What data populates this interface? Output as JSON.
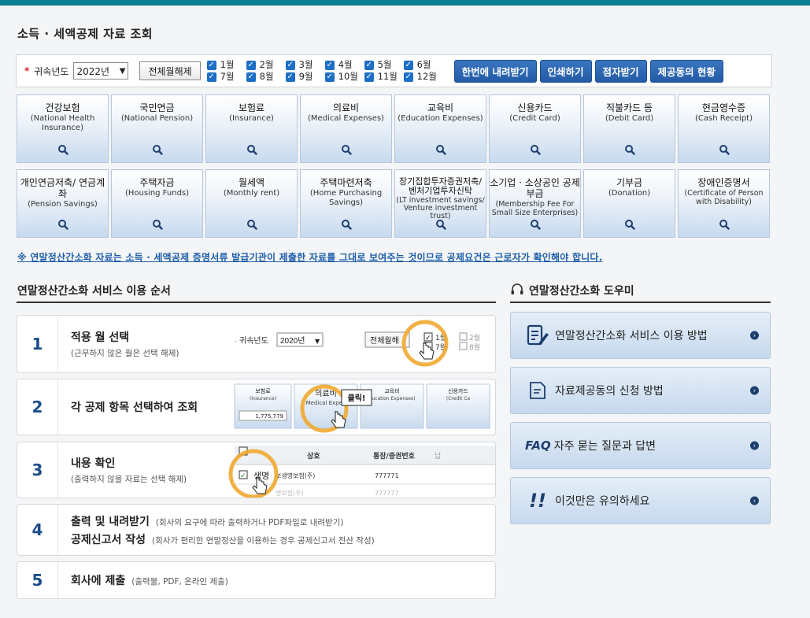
{
  "page_title": "소득 · 세액공제 자료 조회",
  "filter": {
    "required_mark": "*",
    "year_label": "귀속년도",
    "year_value": "2022년",
    "clear_all_label": "전체월해제",
    "months": [
      "1월",
      "2월",
      "3월",
      "4월",
      "5월",
      "6월",
      "7월",
      "8월",
      "9월",
      "10월",
      "11월",
      "12월"
    ],
    "checkbox_mark": "✓",
    "actions": [
      "한번에 내려받기",
      "인쇄하기",
      "점자받기",
      "제공동의 현황"
    ]
  },
  "categories": [
    {
      "title": "건강보험",
      "sub": "(National Health Insurance)"
    },
    {
      "title": "국민연금",
      "sub": "(National Pension)"
    },
    {
      "title": "보험료",
      "sub": "(Insurance)"
    },
    {
      "title": "의료비",
      "sub": "(Medical Expenses)"
    },
    {
      "title": "교육비",
      "sub": "(Education Expenses)"
    },
    {
      "title": "신용카드",
      "sub": "(Credit Card)"
    },
    {
      "title": "직불카드 등",
      "sub": "(Debit Card)"
    },
    {
      "title": "현금영수증",
      "sub": "(Cash Receipt)"
    },
    {
      "title": "개인연금저축/ 연금계좌",
      "sub": "(Pension Savings)"
    },
    {
      "title": "주택자금",
      "sub": "(Housing Funds)"
    },
    {
      "title": "월세액",
      "sub": "(Monthly rent)"
    },
    {
      "title": "주택마련저축",
      "sub": "(Home Purchasing Savings)"
    },
    {
      "title": "장기집합투자증권저축/ 벤처기업투자신탁",
      "sub": "(LT investment savings/ Venture investment trust)"
    },
    {
      "title": "소기업 · 소상공인 공제부금",
      "sub": "(Membership Fee For Small Size Enterprises)"
    },
    {
      "title": "기부금",
      "sub": "(Donation)"
    },
    {
      "title": "장애인증명서",
      "sub": "(Certificate of Person with Disability)"
    }
  ],
  "notice": "※ 연말정산간소화 자료는 소득 · 세액공제 증명서류 발급기관이 제출한 자료를 그대로 보여주는 것이므로 공제요건은 근로자가 확인해야 합니다.",
  "steps_title": "연말정산간소화 서비스 이용 순서",
  "steps": [
    {
      "num": "1",
      "title": "적용 월 선택",
      "sub": "(근무하지 않은 월은 선택 해제)"
    },
    {
      "num": "2",
      "title": "각 공제 항목 선택하여 조회",
      "sub": ""
    },
    {
      "num": "3",
      "title": "내용 확인",
      "sub": "(출력하지 않을 자료는 선택 해제)"
    },
    {
      "num": "4",
      "title": "출력 및 내려받기",
      "sub": "(회사의 요구에 따라 출력하거나 PDF파일로 내려받기)",
      "title2": "공제신고서 작성",
      "sub2": "(회사가 편리한 연말정산을 이용하는 경우 공제신고서 전산 작성)"
    },
    {
      "num": "5",
      "title": "회사에 제출",
      "sub": "(출력물, PDF, 온라인 제출)"
    }
  ],
  "illus1": {
    "year_label": "귀속년도",
    "year_value": "2020년",
    "clear_label": "전체월해",
    "m1": "1월",
    "m2": "2월",
    "m7": "7월",
    "m8": "8월"
  },
  "illus2": {
    "c1": "보험료",
    "c1s": "(Insurance)",
    "c1v": "1,775,779",
    "c2": "의료비",
    "c2s": "Medical Expen",
    "c3": "교육비",
    "c3s": "ducation Expenses)",
    "c4": "신용카드",
    "c4s": "(Credit Ca",
    "tooltip": "클릭!"
  },
  "illus3": {
    "h1": "상호",
    "h2": "통장/증권번호",
    "h3": "납",
    "r1a": "생명",
    "r1b": "보생명보험(주)",
    "r1c": "777771",
    "r2b": "명보험(주)",
    "r2c": "777777"
  },
  "helper_title": "연말정산간소화 도우미",
  "helpers": [
    {
      "label": "연말정산간소화 서비스 이용 방법",
      "icon": "document-edit-icon"
    },
    {
      "label": "자료제공동의 신청 방법",
      "icon": "document-icon"
    },
    {
      "label": "자주 묻는 질문과 답변",
      "icon": "faq-icon",
      "icon_text": "FAQ"
    },
    {
      "label": "이것만은 유의하세요",
      "icon": "exclamation-icon",
      "icon_text": "!!"
    }
  ],
  "colors": {
    "accent": "#225aa6",
    "topbar": "#0c7f92",
    "notice": "#1d5ea8",
    "highlight_ring": "#f0a830"
  }
}
